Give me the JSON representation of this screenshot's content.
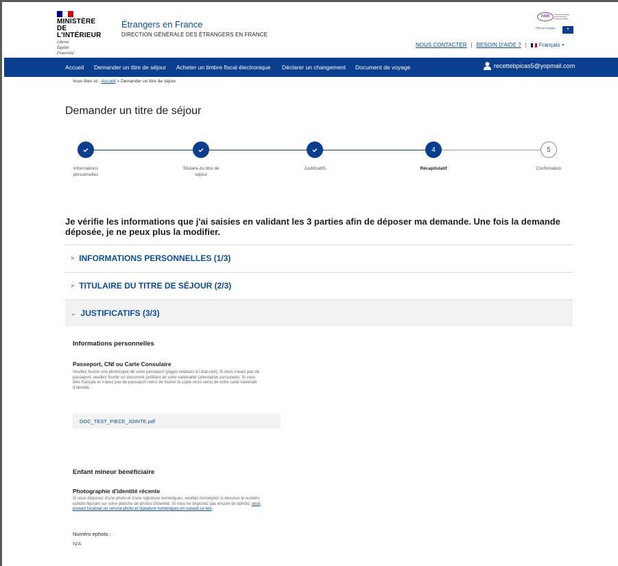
{
  "header": {
    "ministry_name_line1": "MINISTÈRE",
    "ministry_name_line2": "DE L'INTÉRIEUR",
    "motto_line1": "Liberté",
    "motto_line2": "Égalité",
    "motto_line3": "Fraternité",
    "site_title": "Étrangers en France",
    "site_subtitle": "DIRECTION GÉNÉRALE DES ÉTRANGERS EN FRANCE",
    "fami_logo": "FAMI",
    "fami_tagline": "l'Europe s'engage",
    "links": {
      "contact": "NOUS CONTACTER",
      "help": "BESOIN D'AIDE ?",
      "language": "Français"
    },
    "flag_colors": [
      "#000091",
      "#ffffff",
      "#e1000f"
    ]
  },
  "nav": {
    "items": [
      "Accueil",
      "Demander un titre de séjour",
      "Acheter un timbre fiscal électronique",
      "Déclarer un changement",
      "Document de voyage"
    ],
    "user_email": "recettebpicas5@yopmail.com",
    "user_icon": "user-icon",
    "bg_color": "#0a3f8f"
  },
  "breadcrumb": {
    "prefix": "Vous êtes ici :",
    "home": "Accueil",
    "separator": ">",
    "current": "Demander un titre de séjour"
  },
  "page_title": "Demander un titre de séjour",
  "stepper": {
    "steps": [
      {
        "label_line1": "Informations",
        "label_line2": "personnelles",
        "state": "done",
        "number": ""
      },
      {
        "label_line1": "Titulaire du titre de",
        "label_line2": "séjour",
        "state": "done",
        "number": ""
      },
      {
        "label_line1": "Justificatifs",
        "label_line2": "",
        "state": "done",
        "number": ""
      },
      {
        "label_line1": "Récapitulatif",
        "label_line2": "",
        "state": "current",
        "number": "4"
      },
      {
        "label_line1": "Confirmation",
        "label_line2": "",
        "state": "todo",
        "number": "5"
      }
    ],
    "check_icon": "check-icon"
  },
  "intro": "Je vérifie les informations que j'ai saisies en validant les 3 parties afin de déposer ma demande. Une fois la demande déposée, je ne peux plus la modifier.",
  "accordion": [
    {
      "title": "INFORMATIONS PERSONNELLES (1/3)",
      "expanded": false
    },
    {
      "title": "TITULAIRE DU TITRE DE SÉJOUR (2/3)",
      "expanded": false
    },
    {
      "title": "JUSTIFICATIFS (3/3)",
      "expanded": true
    }
  ],
  "justificatifs": {
    "section1_title": "Informations personnelles",
    "doc1_title": "Passeport, CNI ou Carte Consulaire",
    "doc1_help": "Veuillez fournir une photocopie de votre passeport (pages relatives à l'état-civil). Si vous n'avez pas de passeport, veuillez fournir un document justifiant de votre nationalité (attestation consulaire). Si vous êtes français et n'avez pas de passeport merci de fournir la copie recto verso de votre carte nationale d'identité.",
    "doc1_file": "DOC_TEST_PIECE_JOINTE.pdf",
    "section2_title": "Enfant mineur bénéficiaire",
    "doc2_title": "Photographie d'identité récente",
    "doc2_help_text": "Si vous disposez d'une photo et d'une signature numériques, veuillez renseigner ci-dessous le numéro ephoto figurant sur votre planche de photos d'identité. Si vous ne disposez pas encore de ephoto, ",
    "doc2_help_link": "vous pouvez localiser un service photo et signature numériques en suivant ce lien",
    "doc2_help_end": ".",
    "ephoto_label": "Numéro ephoto :",
    "ephoto_value": "N/A"
  }
}
